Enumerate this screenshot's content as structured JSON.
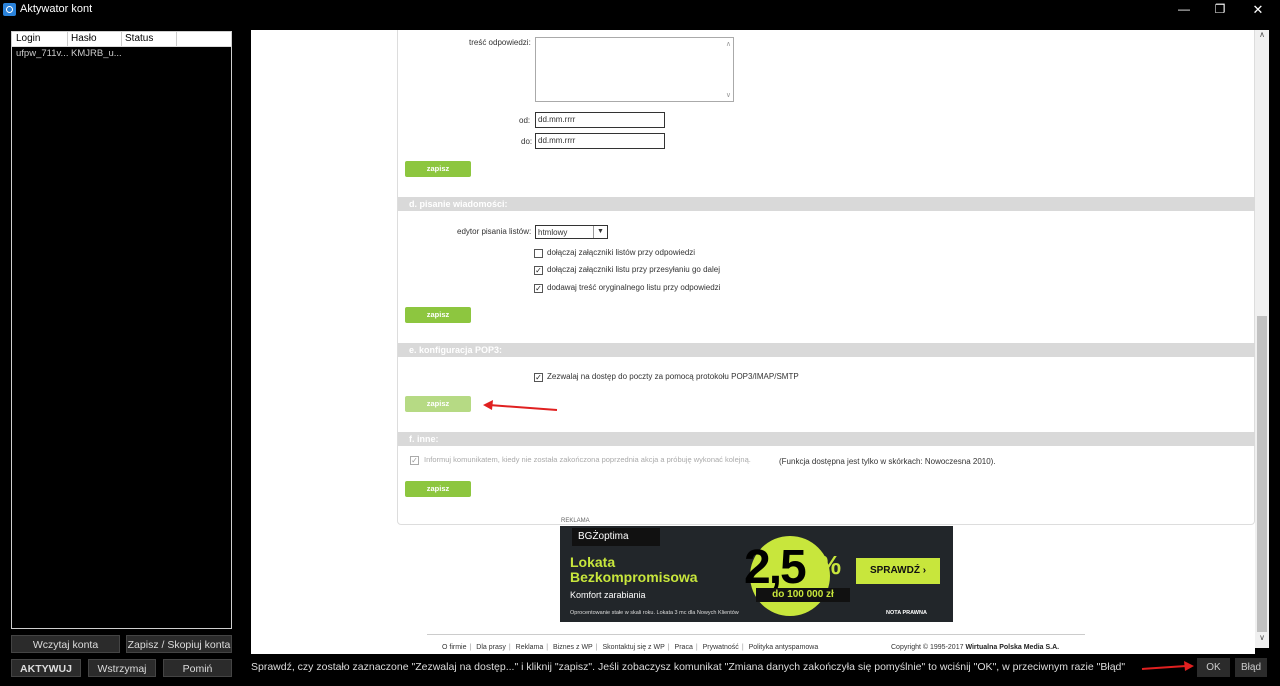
{
  "window": {
    "title": "Aktywator kont"
  },
  "accounts": {
    "columns": [
      "Login",
      "Hasło",
      "Status"
    ],
    "rows": [
      {
        "login": "ufpw_711v...",
        "password": "KMJRB_u...",
        "status": ""
      }
    ]
  },
  "left_buttons": {
    "load": "Wczytaj konta",
    "save": "Zapisz / Skopiuj konta",
    "activate": "AKTYWUJ",
    "pause": "Wstrzymaj",
    "skip": "Pomiń"
  },
  "form": {
    "reply_label": "treść odpowiedzi:",
    "from_label": "od:",
    "from_value": "dd.mm.rrrr",
    "to_label": "do:",
    "to_value": "dd.mm.rrrr",
    "save_label": "zapisz",
    "section_d": "d. pisanie wiadomości:",
    "editor_label": "edytor pisania listów:",
    "editor_value": "htmlowy",
    "checkbox_attach_reply": "dołączaj załączniki listów przy odpowiedzi",
    "checkbox_attach_forward": "dołączaj załączniki listu przy przesyłaniu go dalej",
    "checkbox_original_text": "dodawaj treść oryginalnego listu przy odpowiedzi",
    "section_e": "e. konfiguracja POP3:",
    "checkbox_pop3": "Zezwalaj na dostęp do poczty za pomocą protokołu POP3/IMAP/SMTP",
    "section_f": "f. inne:",
    "checkbox_inform": "Informuj komunikatem, kiedy nie została zakończona poprzednia akcja a próbuję wykonać kolejną.",
    "inform_note": "(Funkcja dostępna jest tylko w skórkach: Nowoczesna 2010)."
  },
  "ad": {
    "label": "REKLAMA",
    "logo": "BGŻoptima",
    "title_line1": "Lokata",
    "title_line2": "Bezkompromisowa",
    "subtitle": "Komfort zarabiania",
    "rate": "2,5",
    "percent": "%",
    "amount": "do 100 000 zł",
    "cta": "SPRAWDŹ  ›",
    "fine_print": "Oprocentowanie stałe w skali roku. Lokata 3 mc dla Nowych Klientów",
    "nota": "NOTA PRAWNA"
  },
  "footer": {
    "links": [
      "O firmie",
      "Dla prasy",
      "Reklama",
      "Biznes z WP",
      "Skontaktuj się z WP",
      "Praca",
      "Prywatność",
      "Polityka antyspamowa"
    ],
    "copyright_prefix": "Copyright © 1995-2017",
    "copyright_company": "Wirtualna Polska Media S.A."
  },
  "bottom_bar": {
    "instruction": "Sprawdź, czy zostało zaznaczone \"Zezwalaj na dostęp...\" i kliknij \"zapisz\". Jeśli zobaczysz komunikat \"Zmiana danych zakończyła się pomyślnie\" to wciśnij \"OK\", w przeciwnym razie \"Błąd\"",
    "ok": "OK",
    "error": "Błąd"
  },
  "colors": {
    "accent_green": "#8dc63f",
    "section_gray": "#d9d9d9",
    "arrow_red": "#e02020"
  }
}
